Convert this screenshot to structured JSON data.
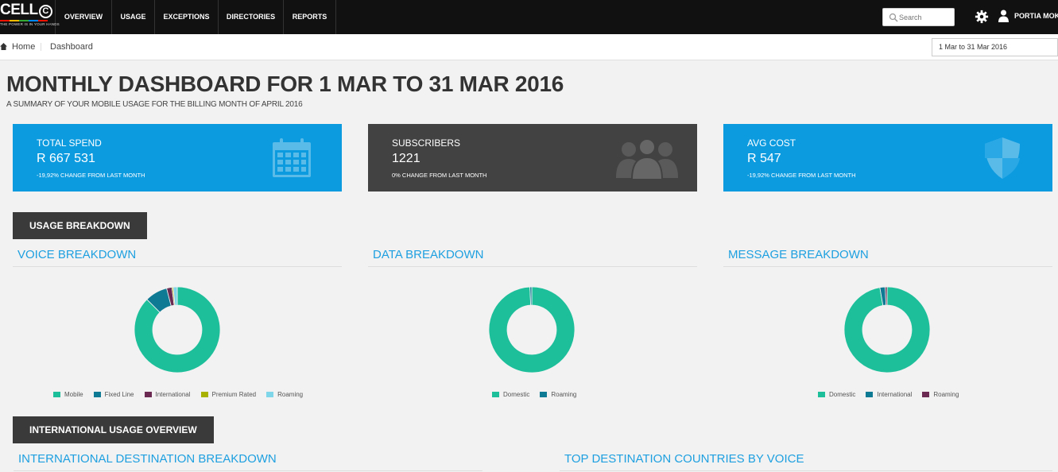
{
  "brand": {
    "word": "CELL",
    "circle_letter": "C",
    "tagline": "THE POWER IS IN YOUR HANDS"
  },
  "nav": {
    "items": [
      "OVERVIEW",
      "USAGE",
      "EXCEPTIONS",
      "DIRECTORIES",
      "REPORTS"
    ],
    "search_placeholder": "Search",
    "user_name": "PORTIA MOKO"
  },
  "breadcrumb": {
    "home": "Home",
    "current": "Dashboard"
  },
  "date_range": "1 Mar to 31 Mar 2016",
  "page": {
    "title": "MONTHLY DASHBOARD FOR 1 MAR TO 31 MAR 2016",
    "subtitle": "A SUMMARY OF YOUR MOBILE USAGE FOR THE BILLING MONTH OF APRIL 2016"
  },
  "tiles": [
    {
      "label": "TOTAL SPEND",
      "value": "R 667 531",
      "change": "-19,92% CHANGE FROM LAST MONTH",
      "color": "#0d9be0",
      "icon": "calendar-icon"
    },
    {
      "label": "SUBSCRIBERS",
      "value": "1221",
      "change": "0% CHANGE FROM LAST MONTH",
      "color": "#424242",
      "icon": "users-icon"
    },
    {
      "label": "AVG COST",
      "value": "R 547",
      "change": "-19,92% CHANGE FROM LAST MONTH",
      "color": "#0d9be0",
      "icon": "shield-icon"
    }
  ],
  "sections": {
    "usage": "USAGE BREAKDOWN",
    "international": "INTERNATIONAL USAGE OVERVIEW"
  },
  "panels": {
    "voice": "VOICE BREAKDOWN",
    "data": "DATA BREAKDOWN",
    "message": "MESSAGE BREAKDOWN",
    "intl_dest": "INTERNATIONAL DESTINATION BREAKDOWN",
    "top_dest": "TOP DESTINATION COUNTRIES BY VOICE"
  },
  "chart_data": [
    {
      "type": "pie",
      "donut": true,
      "categories": [
        "Mobile",
        "Fixed Line",
        "International",
        "Premium Rated",
        "Roaming"
      ],
      "values": [
        87.5,
        8.5,
        2,
        0.5,
        1.5
      ],
      "colors": [
        "#1dbf9b",
        "#0f7a93",
        "#6a2a52",
        "#a8b000",
        "#7fd6e8"
      ]
    },
    {
      "type": "pie",
      "donut": true,
      "categories": [
        "Domestic",
        "Roaming"
      ],
      "values": [
        99.3,
        0.7
      ],
      "colors": [
        "#1dbf9b",
        "#0f7a93"
      ]
    },
    {
      "type": "pie",
      "donut": true,
      "categories": [
        "Domestic",
        "International",
        "Roaming"
      ],
      "values": [
        97.3,
        2,
        0.7
      ],
      "colors": [
        "#1dbf9b",
        "#0f7a93",
        "#6a2a52"
      ]
    }
  ]
}
